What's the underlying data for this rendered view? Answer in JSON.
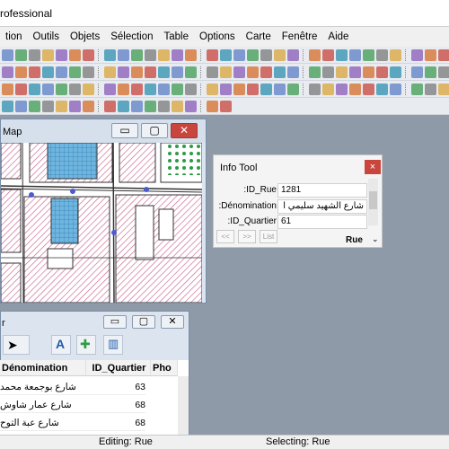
{
  "app": {
    "title": "rofessional"
  },
  "menu": [
    "tion",
    "Outils",
    "Objets",
    "Sélection",
    "Table",
    "Options",
    "Carte",
    "Fenêtre",
    "Aide"
  ],
  "colors": {
    "window_bg": "#8e9aa8",
    "close_button": "#c8463e",
    "map_hatch": "#c9658d",
    "map_blue": "#5ba8d6",
    "map_green": "#2e9b45"
  },
  "map_window": {
    "title": "Map",
    "minimize_icon": "minimize-icon",
    "restore_icon": "restore-icon",
    "close_icon": "close-icon"
  },
  "info_tool": {
    "title": "Info Tool",
    "close_label": "×",
    "fields": [
      {
        "label": ":ID_Rue",
        "value": "1281"
      },
      {
        "label": ":Dénomination",
        "value": "شارع الشهيد سليمي ا"
      },
      {
        "label": ":ID_Quartier",
        "value": "61"
      }
    ],
    "nav": [
      "<<",
      ">>",
      "List"
    ],
    "layer": "Rue"
  },
  "browser": {
    "title": "r",
    "columns": [
      "Dénomination",
      "ID_Quartier",
      "Pho"
    ],
    "rows": [
      {
        "denomination": "شارع بوجمعة محمد",
        "id_quartier": "63"
      },
      {
        "denomination": "شارع عمار شاوش",
        "id_quartier": "68"
      },
      {
        "denomination": "شارع عبة التوح",
        "id_quartier": "68"
      }
    ]
  },
  "status": {
    "editing": "Editing: Rue",
    "selecting": "Selecting: Rue"
  }
}
